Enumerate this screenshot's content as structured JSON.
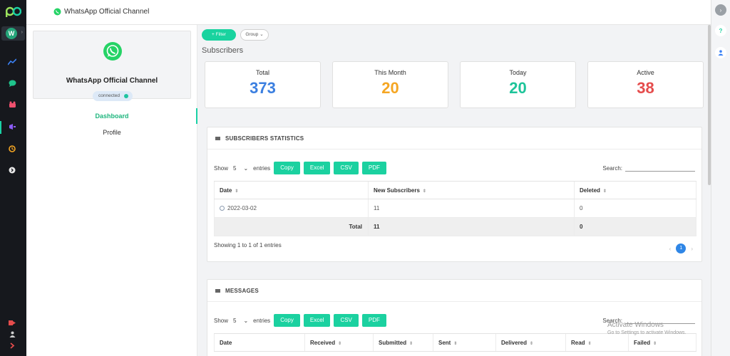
{
  "app": {
    "title": "WhatsApp Official Channel",
    "user_initial": "W"
  },
  "channel": {
    "name": "WhatsApp Official Channel",
    "status": "connected"
  },
  "nav": {
    "items": [
      {
        "label": "Dashboard",
        "active": true
      },
      {
        "label": "Profile",
        "active": false
      }
    ]
  },
  "toolbar": {
    "filter_label": "+ Filter",
    "group_label": "Group"
  },
  "subscribers": {
    "title": "Subscribers",
    "stats": [
      {
        "label": "Total",
        "value": "373",
        "color": "#3b7fe0"
      },
      {
        "label": "This Month",
        "value": "20",
        "color": "#f5a623"
      },
      {
        "label": "Today",
        "value": "20",
        "color": "#1ec49a"
      },
      {
        "label": "Active",
        "value": "38",
        "color": "#e54c4c"
      }
    ]
  },
  "subscribers_stats": {
    "title": "SUBSCRIBERS STATISTICS",
    "show_label": "Show",
    "entries_value": "5",
    "entries_label": "entries",
    "buttons": [
      "Copy",
      "Excel",
      "CSV",
      "PDF"
    ],
    "search_label": "Search:",
    "columns": [
      "Date",
      "New Subscribers",
      "Deleted"
    ],
    "rows": [
      {
        "date": "2022-03-02",
        "new": "11",
        "deleted": "0"
      }
    ],
    "total": {
      "label": "Total",
      "new": "11",
      "deleted": "0"
    },
    "info": "Showing 1 to 1 of 1 entries",
    "page": {
      "prev": "‹",
      "current": "1",
      "next": "›"
    }
  },
  "messages": {
    "title": "MESSAGES",
    "show_label": "Show",
    "entries_value": "5",
    "entries_label": "entries",
    "buttons": [
      "Copy",
      "Excel",
      "CSV",
      "PDF"
    ],
    "search_label": "Search:",
    "columns": [
      "Date",
      "Received",
      "Submitted",
      "Sent",
      "Delivered",
      "Read",
      "Failed"
    ]
  },
  "watermark": {
    "line1": "Activate Windows",
    "line2": "Go to Settings to activate Windows."
  },
  "colors": {
    "accent": "#1bd1a0",
    "sidebar": "#16181d",
    "whatsapp": "#25d366"
  }
}
